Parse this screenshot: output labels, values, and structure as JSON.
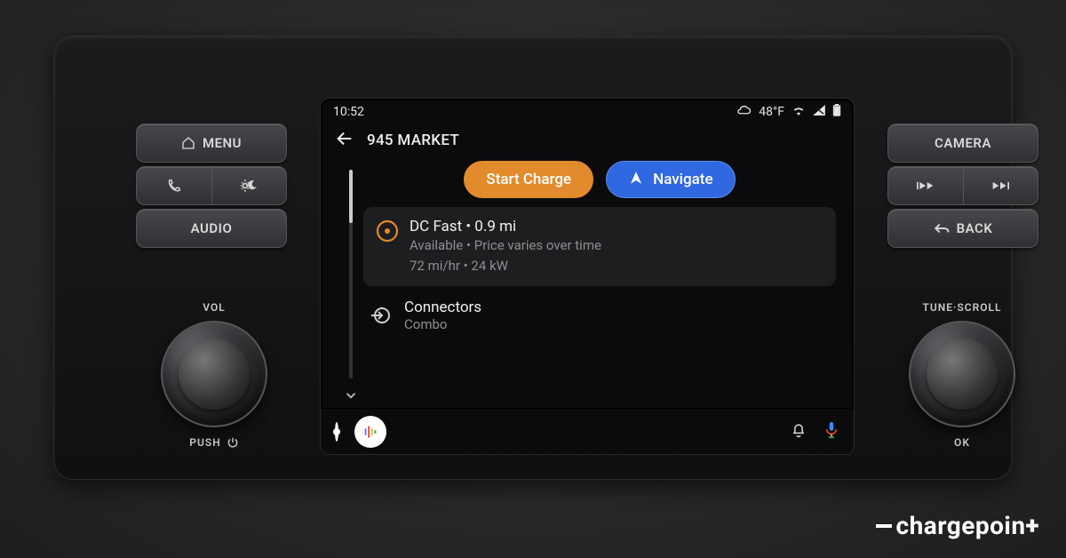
{
  "physical": {
    "menu_label": "MENU",
    "audio_label": "AUDIO",
    "camera_label": "CAMERA",
    "back_label": "BACK",
    "vol_label": "VOL",
    "push_label": "PUSH",
    "tune_label": "TUNE·SCROLL",
    "ok_label": "OK"
  },
  "status": {
    "time": "10:52",
    "weather_temp": "48°F"
  },
  "header": {
    "title": "945 MARKET"
  },
  "actions": {
    "start_charge": "Start Charge",
    "navigate": "Navigate"
  },
  "station_card": {
    "title": "DC Fast • 0.9 mi",
    "line1": "Available • Price varies over time",
    "line2": "72 mi/hr • 24 kW"
  },
  "connectors": {
    "title": "Connectors",
    "value": "Combo"
  },
  "watermark": {
    "prefix": "charge",
    "suffix": "poin"
  }
}
